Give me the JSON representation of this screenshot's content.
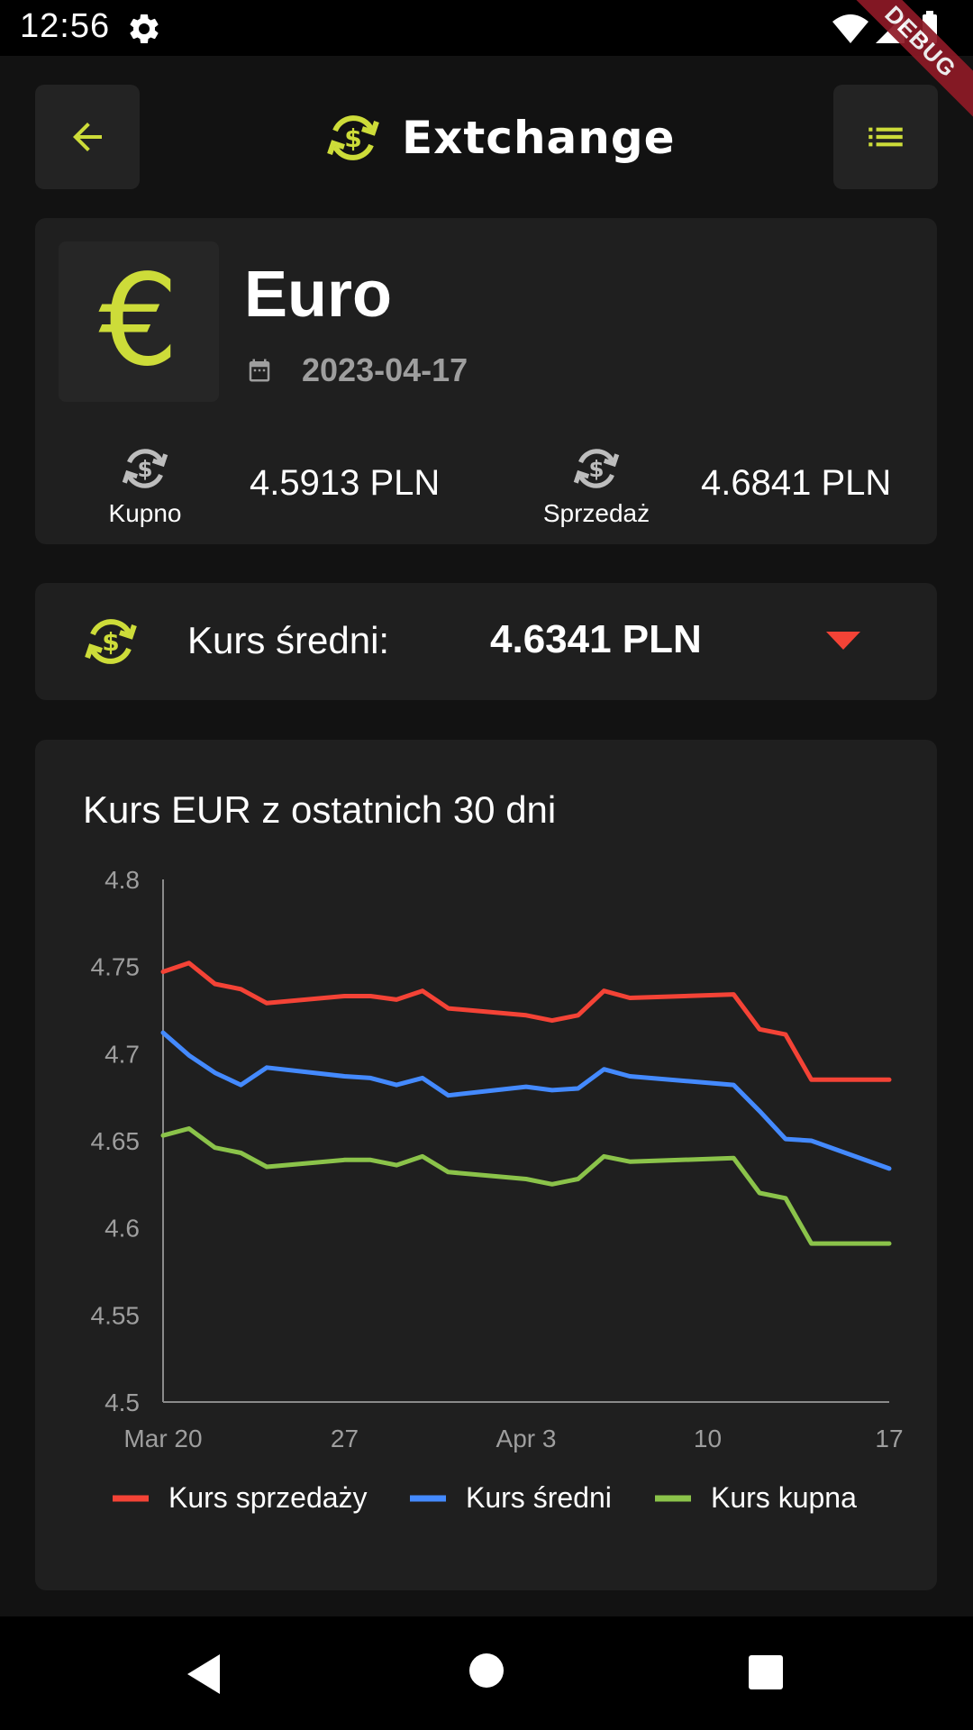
{
  "status_bar": {
    "time": "12:56",
    "debug_label": "DEBUG"
  },
  "header": {
    "title": "Extchange",
    "back_icon": "arrow-left-icon",
    "menu_icon": "list-icon",
    "logo_icon": "currency-exchange-icon"
  },
  "currency": {
    "symbol": "€",
    "name": "Euro",
    "date": "2023-04-17",
    "buy_label": "Kupno",
    "buy_value": "4.5913 PLN",
    "sell_label": "Sprzedaż",
    "sell_value": "4.6841 PLN"
  },
  "average": {
    "label": "Kurs średni:",
    "value": "4.6341 PLN",
    "trend": "down"
  },
  "colors": {
    "accent": "#cddc39",
    "sell": "#f44336",
    "avg": "#448aff",
    "buy": "#8bc34a",
    "trend_down": "#f44336"
  },
  "chart_data": {
    "type": "line",
    "title": "Kurs EUR z ostatnich 30 dni",
    "xlabel": "",
    "ylabel": "",
    "ylim": [
      4.5,
      4.8
    ],
    "yticks": [
      "4.8",
      "4.75",
      "4.7",
      "4.65",
      "4.6",
      "4.55",
      "4.5"
    ],
    "xticks": [
      {
        "label": "Mar 20",
        "day": 0
      },
      {
        "label": "27",
        "day": 7
      },
      {
        "label": "Apr 3",
        "day": 14
      },
      {
        "label": "10",
        "day": 21
      },
      {
        "label": "17",
        "day": 28
      }
    ],
    "x": [
      "2023-03-20",
      "2023-03-21",
      "2023-03-22",
      "2023-03-23",
      "2023-03-24",
      "2023-03-27",
      "2023-03-28",
      "2023-03-29",
      "2023-03-30",
      "2023-03-31",
      "2023-04-03",
      "2023-04-04",
      "2023-04-05",
      "2023-04-06",
      "2023-04-07",
      "2023-04-11",
      "2023-04-12",
      "2023-04-13",
      "2023-04-14",
      "2023-04-17"
    ],
    "x_day": [
      0,
      1,
      2,
      3,
      4,
      7,
      8,
      9,
      10,
      11,
      14,
      15,
      16,
      17,
      18,
      22,
      23,
      24,
      25,
      28
    ],
    "series": [
      {
        "name": "Kurs sprzedaży",
        "color": "#f44336",
        "values": [
          4.747,
          4.752,
          4.74,
          4.737,
          4.729,
          4.733,
          4.733,
          4.731,
          4.736,
          4.726,
          4.722,
          4.719,
          4.722,
          4.736,
          4.732,
          4.734,
          4.714,
          4.711,
          4.685,
          4.685
        ]
      },
      {
        "name": "Kurs średni",
        "color": "#448aff",
        "values": [
          4.712,
          4.699,
          4.689,
          4.682,
          4.692,
          4.687,
          4.686,
          4.682,
          4.686,
          4.676,
          4.681,
          4.679,
          4.68,
          4.691,
          4.687,
          4.682,
          4.667,
          4.651,
          4.65,
          4.634
        ]
      },
      {
        "name": "Kurs kupna",
        "color": "#8bc34a",
        "values": [
          4.653,
          4.657,
          4.646,
          4.643,
          4.635,
          4.639,
          4.639,
          4.636,
          4.641,
          4.632,
          4.628,
          4.625,
          4.628,
          4.641,
          4.638,
          4.64,
          4.62,
          4.617,
          4.591,
          4.591
        ]
      }
    ],
    "grid": false,
    "legend": "bottom"
  }
}
